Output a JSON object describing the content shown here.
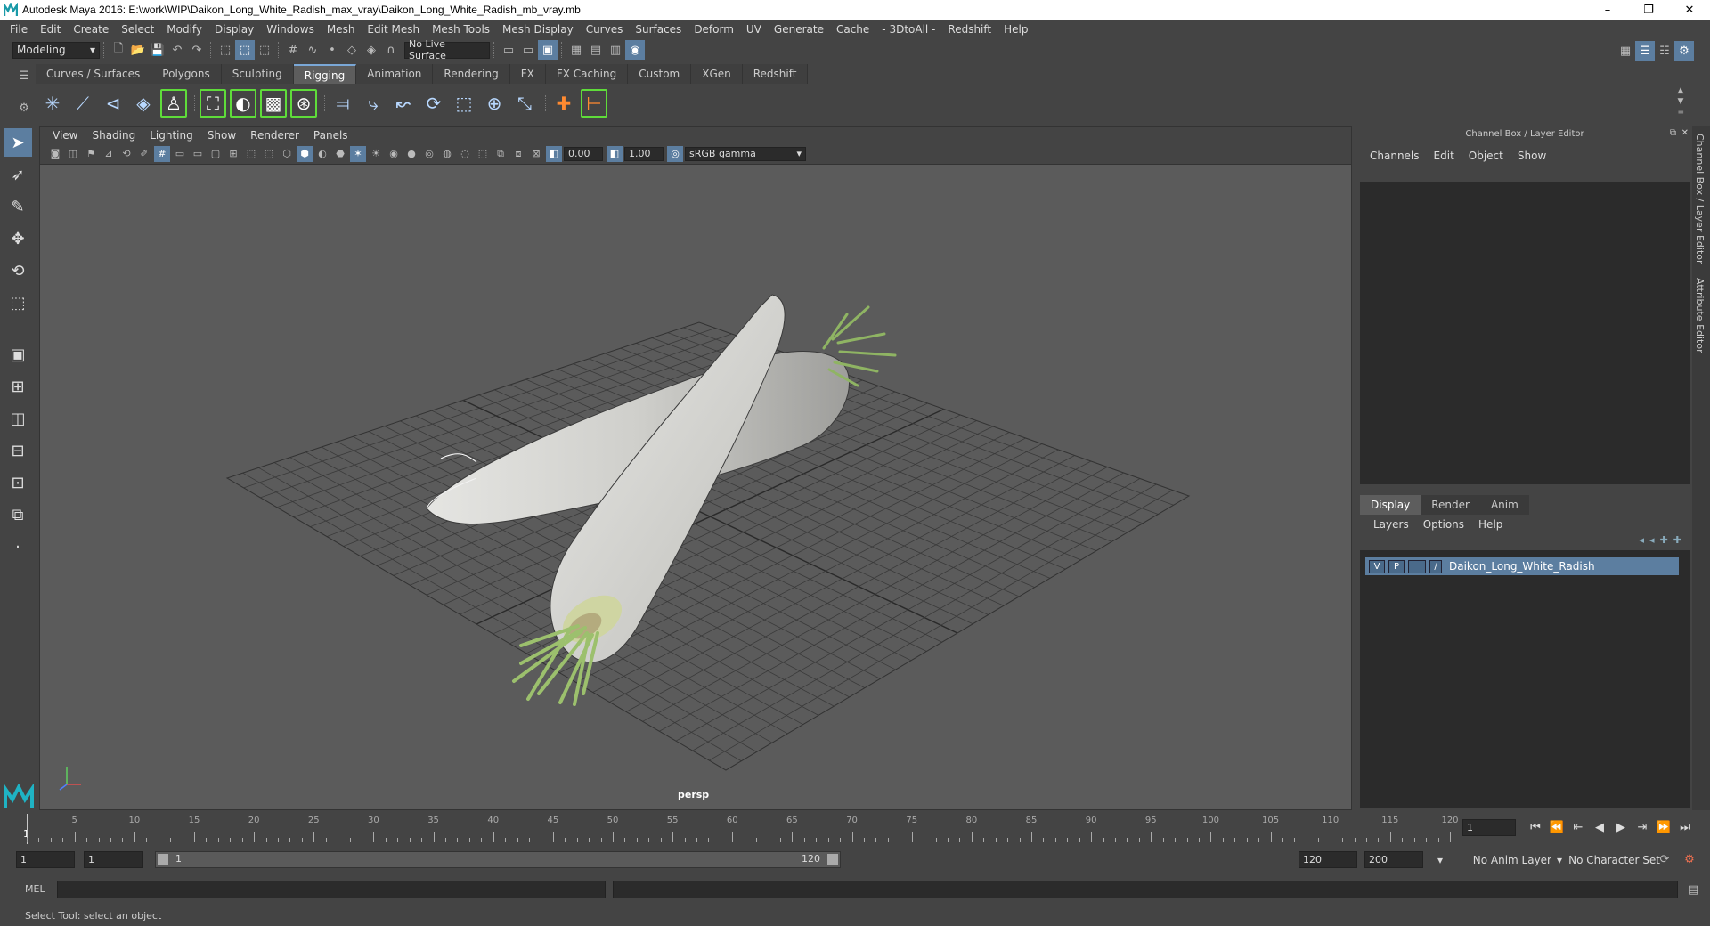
{
  "window": {
    "title": "Autodesk Maya 2016: E:\\work\\WIP\\Daikon_Long_White_Radish_max_vray\\Daikon_Long_White_Radish_mb_vray.mb",
    "minimize": "–",
    "restore": "❐",
    "close": "✕"
  },
  "menus": [
    "File",
    "Edit",
    "Create",
    "Select",
    "Modify",
    "Display",
    "Windows",
    "Mesh",
    "Edit Mesh",
    "Mesh Tools",
    "Mesh Display",
    "Curves",
    "Surfaces",
    "Deform",
    "UV",
    "Generate",
    "Cache",
    "- 3DtoAll -",
    "Redshift",
    "Help"
  ],
  "status_line": {
    "mode": "Modeling",
    "live_surface": "No Live Surface"
  },
  "shelf_tabs": [
    {
      "label": "Curves / Surfaces",
      "active": false
    },
    {
      "label": "Polygons",
      "active": false
    },
    {
      "label": "Sculpting",
      "active": false
    },
    {
      "label": "Rigging",
      "active": true
    },
    {
      "label": "Animation",
      "active": false
    },
    {
      "label": "Rendering",
      "active": false
    },
    {
      "label": "FX",
      "active": false
    },
    {
      "label": "FX Caching",
      "active": false
    },
    {
      "label": "Custom",
      "active": false
    },
    {
      "label": "XGen",
      "active": false
    },
    {
      "label": "Redshift",
      "active": false
    }
  ],
  "viewport": {
    "menus": [
      "View",
      "Shading",
      "Lighting",
      "Show",
      "Renderer",
      "Panels"
    ],
    "exposure": "0.00",
    "gamma": "1.00",
    "color_space": "sRGB gamma",
    "camera": "persp"
  },
  "channel_box": {
    "title": "Channel Box / Layer Editor",
    "menus": [
      "Channels",
      "Edit",
      "Object",
      "Show"
    ]
  },
  "layer_editor": {
    "tabs": [
      {
        "label": "Display",
        "active": true
      },
      {
        "label": "Render",
        "active": false
      },
      {
        "label": "Anim",
        "active": false
      }
    ],
    "menus": [
      "Layers",
      "Options",
      "Help"
    ],
    "layer": {
      "visible": "V",
      "playback": "P",
      "name": "Daikon_Long_White_Radish"
    }
  },
  "side_tabs": [
    "Channel Box / Layer Editor",
    "Attribute Editor"
  ],
  "timeline": {
    "ticks": [
      "5",
      "10",
      "15",
      "20",
      "25",
      "30",
      "35",
      "40",
      "45",
      "50",
      "55",
      "60",
      "65",
      "70",
      "75",
      "80",
      "85",
      "90",
      "95",
      "100",
      "105",
      "110",
      "115",
      "120"
    ],
    "start_marker": "1",
    "current_frame": "1"
  },
  "range": {
    "start": "1",
    "anim_start": "1",
    "slider_start": "1",
    "slider_end": "120",
    "end": "120",
    "anim_end": "200",
    "anim_layer": "No Anim Layer",
    "char_set": "No Character Set"
  },
  "command_line": {
    "label": "MEL"
  },
  "help_line": "Select Tool: select an object",
  "colors": {
    "accent": "#5c7ea0",
    "shelf_green": "#5fdc3a",
    "viewport": "#5b5b5b"
  }
}
